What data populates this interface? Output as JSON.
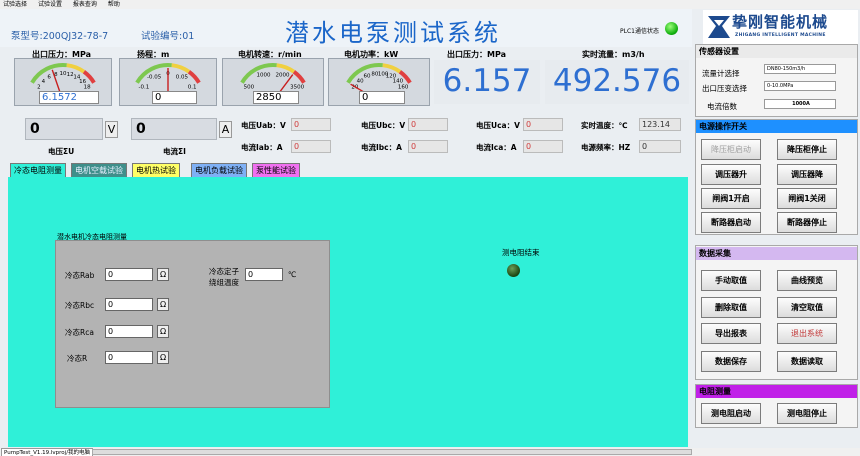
{
  "menu": [
    "试验选择",
    "试验设置",
    "报表查询",
    "帮助"
  ],
  "header": {
    "pump_model_label": "泵型号:",
    "pump_model": "200QJ32-78-7",
    "test_no_label": "试验编号:",
    "test_no": "01",
    "title": "潜水电泵测试系统",
    "plc_label": "PLC1通信状态",
    "plc_status_color": "#12b00f"
  },
  "logo": {
    "title": "挚刚智能机械",
    "subtitle": "ZHIGANG INTELLIGENT MACHINE",
    "color": "#1d4a8e"
  },
  "gauges": [
    {
      "label": "出口压力：MPa",
      "ticks": [
        "2",
        "4",
        "6",
        "8",
        "10",
        "12",
        "14",
        "16",
        "18"
      ],
      "value": "6.1572",
      "fraction": 0.34
    },
    {
      "label": "扬程：m",
      "ticks": [
        "-0.1",
        "-0.05",
        "0",
        "0.05",
        "0.1"
      ],
      "value": "0",
      "fraction": 0.5
    },
    {
      "label": "电机转速：r/min",
      "ticks": [
        "500",
        "1000",
        "2000",
        "3500"
      ],
      "value": "2850",
      "fraction": 0.81
    },
    {
      "label": "电机功率：kW",
      "ticks": [
        "20",
        "40",
        "60",
        "80",
        "100",
        "120",
        "140",
        "160"
      ],
      "value": "0",
      "fraction": 0.0
    }
  ],
  "outlet_pressure": {
    "label": "出口压力：MPa",
    "value": "6.157"
  },
  "flow": {
    "label": "实时流量：m3/h",
    "value": "492.576"
  },
  "electrical": {
    "voltage": {
      "value": "0",
      "unit": "V",
      "label": "电压ΣU"
    },
    "current": {
      "value": "0",
      "unit": "A",
      "label": "电流ΣI"
    },
    "uab": {
      "label": "电压Uab：V",
      "value": "0"
    },
    "ubc": {
      "label": "电压Ubc：V",
      "value": "0"
    },
    "uca": {
      "label": "电压Uca：V",
      "value": "0"
    },
    "temp": {
      "label": "实时温度：℃",
      "value": "123.14"
    },
    "iab": {
      "label": "电流Iab：A",
      "value": "0"
    },
    "ibc": {
      "label": "电流Ibc：A",
      "value": "0"
    },
    "ica": {
      "label": "电流Ica：A",
      "value": "0"
    },
    "freq": {
      "label": "电源频率：HZ",
      "value": "0"
    }
  },
  "tabs": [
    {
      "label": "冷态电阻测量",
      "color": "#2ff0d8",
      "text_color": "#000000"
    },
    {
      "label": "电机空载试验",
      "color": "#3f8f8b",
      "text_color": "#e8f0ff"
    },
    {
      "label": "电机热试验",
      "color": "#ffff66",
      "text_color": "#000000"
    },
    {
      "label": "电机负载试验",
      "color": "#7fb0f5",
      "text_color": "#000000"
    },
    {
      "label": "泵性能试验",
      "color": "#f070f0",
      "text_color": "#000000"
    }
  ],
  "cold_resistance": {
    "title": "潜水电机冷态电阻测量",
    "rows": [
      {
        "label": "冷态Rab",
        "value": "0",
        "unit": "Ω"
      },
      {
        "label": "冷态Rbc",
        "value": "0",
        "unit": "Ω"
      },
      {
        "label": "冷态Rca",
        "value": "0",
        "unit": "Ω"
      },
      {
        "label": "冷态R",
        "value": "0",
        "unit": "Ω"
      }
    ],
    "stator_label_1": "冷态定子",
    "stator_label_2": "绕组温度",
    "stator_value": "0",
    "stator_unit": "℃",
    "measure_end_label": "测电阻结束"
  },
  "status_path": "PumpTest_V1.19.lvproj/我的电脑",
  "sidebar": {
    "sensor": {
      "title": "传感器设置",
      "head_color": "#eaeaea",
      "flowmeter_label": "流量计选择",
      "flowmeter_value": "DN80-150m3/h",
      "pressure_label": "出口压变选择",
      "pressure_value": "0-10.0MPa",
      "ratio_label": "电流倍数",
      "ratio_value": "1000A"
    },
    "power": {
      "title": "电源操作开关",
      "head_color": "#1e90ff",
      "buttons": [
        {
          "label": "降压柜启动",
          "state": "disabled"
        },
        {
          "label": "降压柜停止",
          "state": "normal"
        },
        {
          "label": "调压器升",
          "state": "normal"
        },
        {
          "label": "调压器降",
          "state": "normal"
        },
        {
          "label": "闸阀1开启",
          "state": "normal"
        },
        {
          "label": "闸阀1关闭",
          "state": "normal"
        },
        {
          "label": "断路器启动",
          "state": "normal"
        },
        {
          "label": "断路器停止",
          "state": "normal"
        }
      ]
    },
    "data": {
      "title": "数据采集",
      "head_color": "#d4b8f0",
      "buttons": [
        {
          "label": "手动取值",
          "state": "normal"
        },
        {
          "label": "曲线预览",
          "state": "normal"
        },
        {
          "label": "删除取值",
          "state": "normal"
        },
        {
          "label": "清空取值",
          "state": "normal"
        },
        {
          "label": "导出报表",
          "state": "normal"
        },
        {
          "label": "退出系统",
          "state": "red"
        },
        {
          "label": "数据保存",
          "state": "normal"
        },
        {
          "label": "数据读取",
          "state": "normal"
        }
      ]
    },
    "resist": {
      "title": "电阻测量",
      "head_color": "#c020e8",
      "buttons": [
        {
          "label": "测电阻启动",
          "state": "normal"
        },
        {
          "label": "测电阻停止",
          "state": "normal"
        }
      ]
    }
  }
}
